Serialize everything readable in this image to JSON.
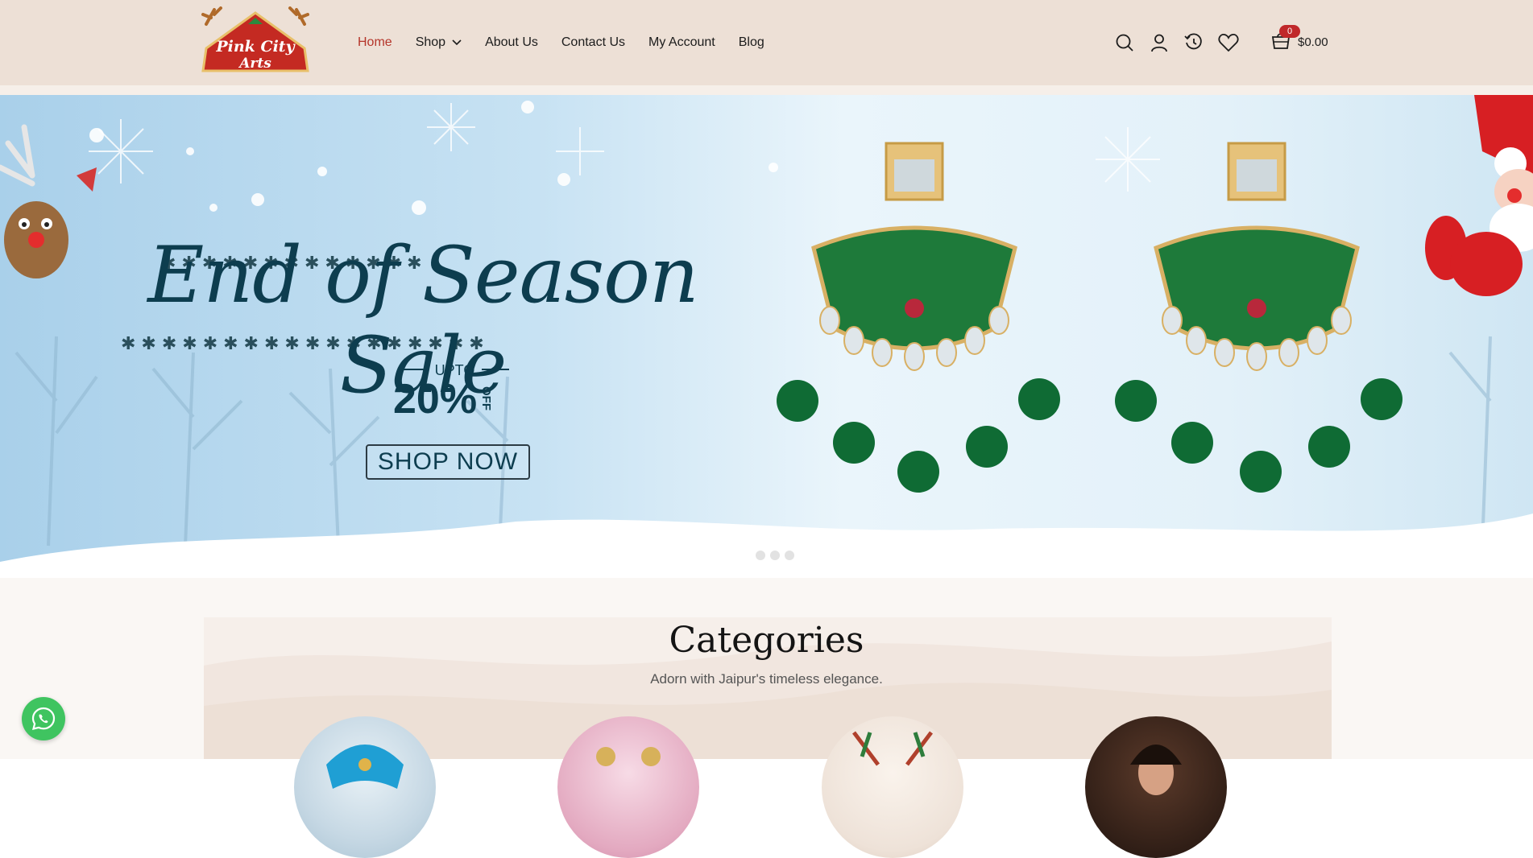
{
  "brand": {
    "logo_line1": "Pink City",
    "logo_line2": "Arts"
  },
  "nav": {
    "items": [
      {
        "label": "Home",
        "active": true
      },
      {
        "label": "Shop",
        "has_dropdown": true
      },
      {
        "label": "About Us"
      },
      {
        "label": "Contact Us"
      },
      {
        "label": "My Account"
      },
      {
        "label": "Blog"
      }
    ]
  },
  "header_icons": [
    "search-icon",
    "user-icon",
    "history-icon",
    "heart-icon"
  ],
  "cart": {
    "count": "0",
    "total": "$0.00"
  },
  "hero": {
    "title": "End of Season Sale",
    "upto": "UPTO",
    "discount": "20%",
    "discount_suffix": "OFF",
    "cta": "SHOP NOW",
    "slides": 3
  },
  "categories": {
    "title": "Categories",
    "subtitle": "Adorn with Jaipur's timeless elegance."
  },
  "colors": {
    "header_bg": "#ede0d6",
    "active_nav": "#b5352a",
    "hero_text": "#0d3d4f",
    "whatsapp": "#3fc460"
  }
}
